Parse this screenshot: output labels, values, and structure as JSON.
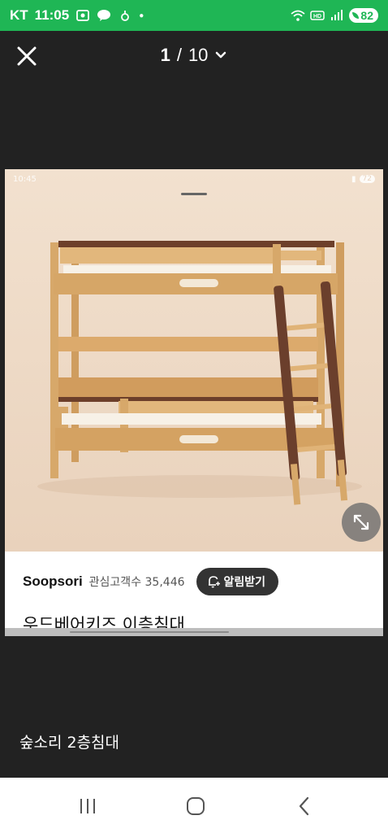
{
  "status_bar": {
    "carrier": "KT",
    "time": "11:05",
    "battery": "82",
    "color": "#1fb655"
  },
  "viewer": {
    "current_page": "1",
    "separator": "/",
    "total_pages": "10"
  },
  "screenshot": {
    "inner_time": "10:45",
    "inner_battery": "72"
  },
  "store": {
    "name": "Soopsori",
    "watchers": "관심고객수 35,446",
    "alarm_label": "알림받기"
  },
  "product": {
    "title": "우드베어키즈 이층침대"
  },
  "caption": "숲소리 2층침대",
  "icons": [
    "close-icon",
    "chevron-down-icon",
    "expand-icon",
    "bell-plus-icon",
    "recent-apps-icon",
    "home-icon",
    "back-icon"
  ]
}
